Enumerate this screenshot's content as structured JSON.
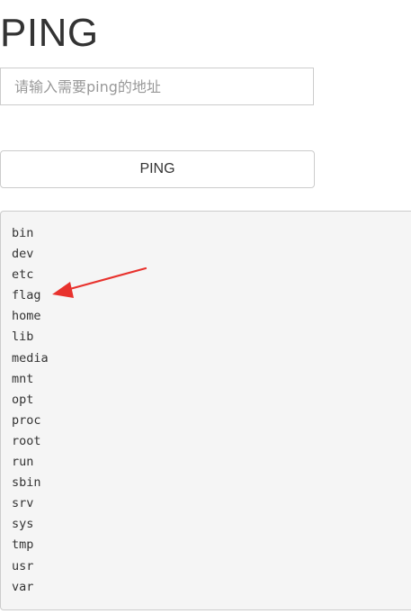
{
  "header": {
    "title": "PING"
  },
  "form": {
    "address_placeholder": "请输入需要ping的地址",
    "address_value": "",
    "submit_label": "PING"
  },
  "output": {
    "lines": [
      "bin",
      "dev",
      "etc",
      "flag",
      "home",
      "lib",
      "media",
      "mnt",
      "opt",
      "proc",
      "root",
      "run",
      "sbin",
      "srv",
      "sys",
      "tmp",
      "usr",
      "var"
    ]
  },
  "annotation": {
    "icon": "arrow-icon",
    "points_to": "flag",
    "color": "#e8322d"
  }
}
